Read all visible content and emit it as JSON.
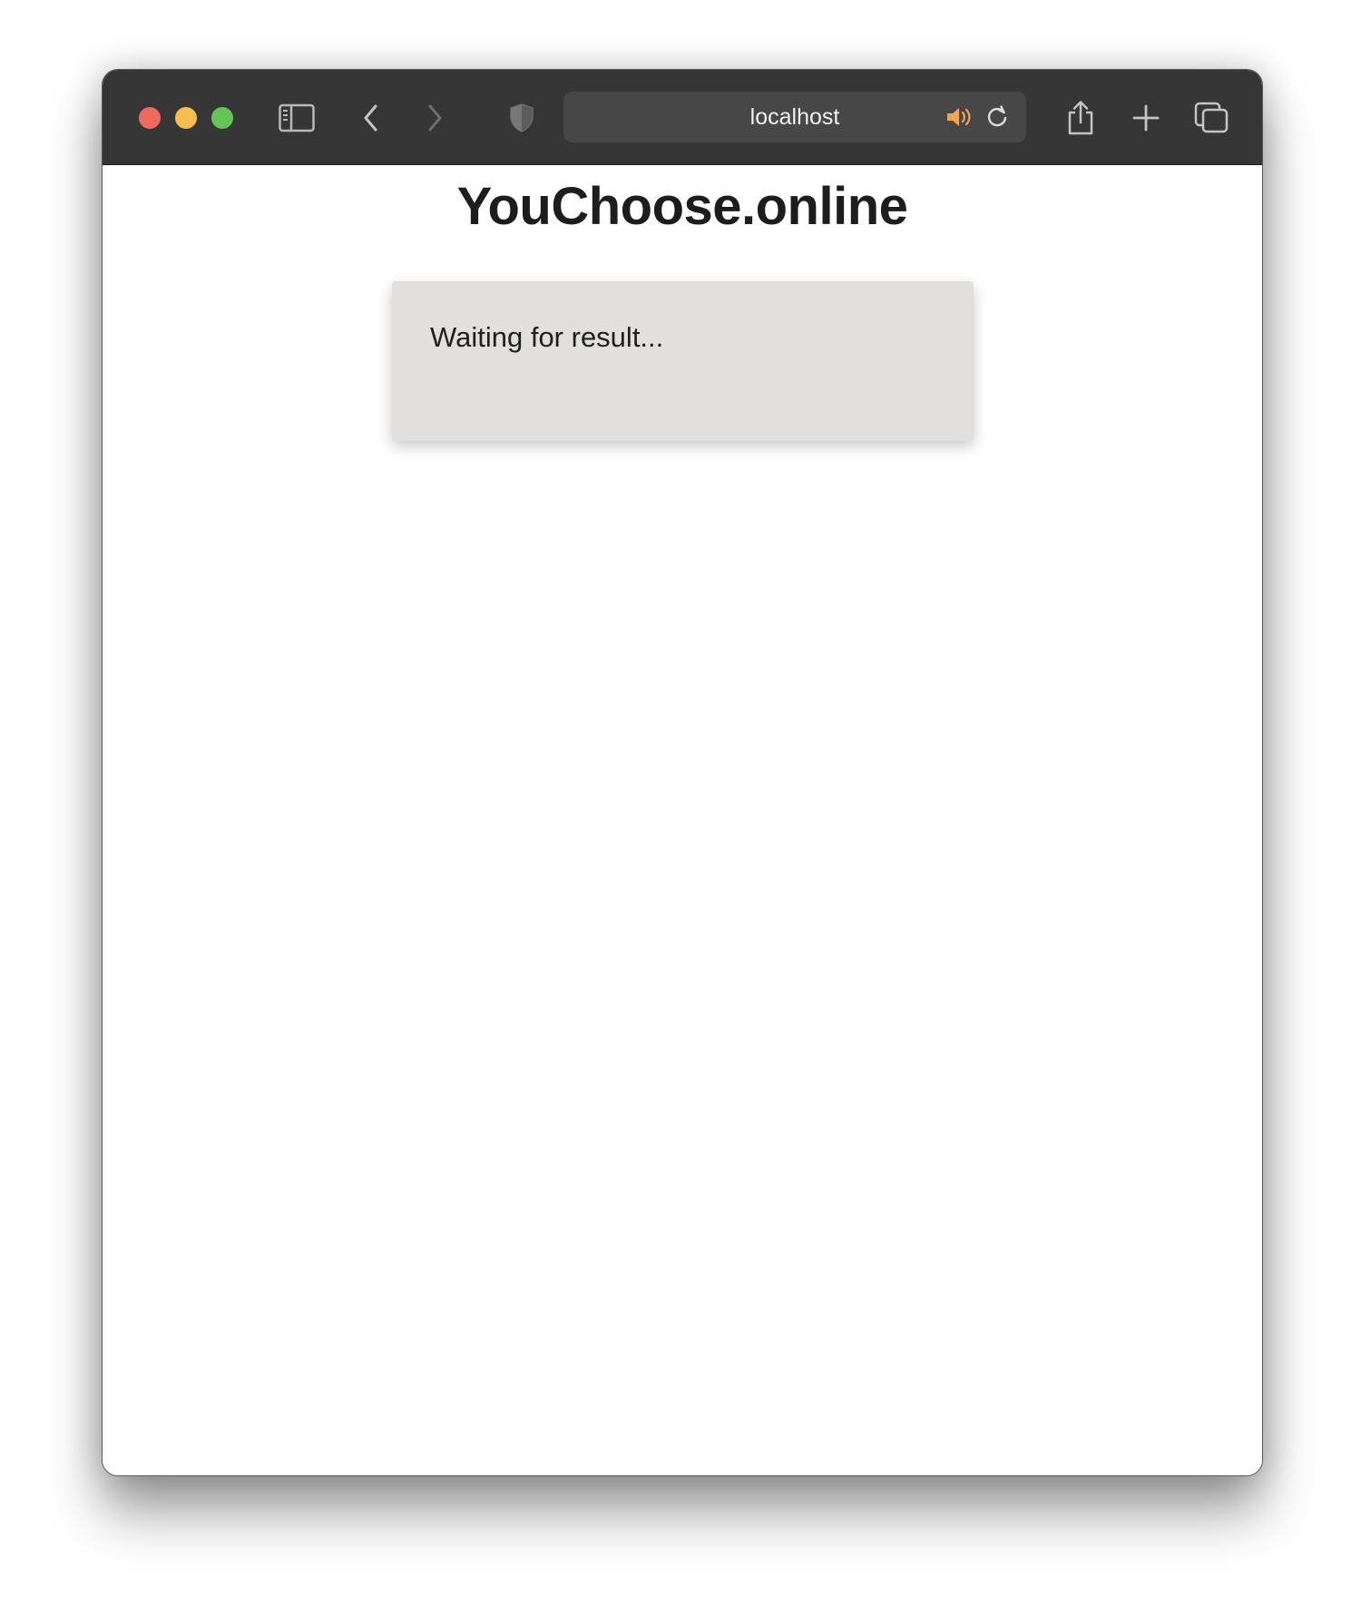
{
  "browser": {
    "address": "localhost",
    "icons": {
      "sidebar": "sidebar-icon",
      "back": "chevron-left-icon",
      "forward": "chevron-right-icon",
      "privacy": "shield-icon",
      "audio": "speaker-icon",
      "reload": "reload-icon",
      "share": "share-icon",
      "new_tab": "plus-icon",
      "tab_overview": "tabs-icon"
    },
    "colors": {
      "toolbar": "#363636",
      "address_bar": "#474747",
      "close": "#ee6a5e",
      "minimize": "#f5be4f",
      "zoom": "#62c554",
      "audio_accent": "#f0a45a"
    }
  },
  "page": {
    "title": "YouChoose.online",
    "status_text": "Waiting for result...",
    "colors": {
      "card_background": "#e1e0df",
      "title_text": "#1d1d1f"
    }
  }
}
